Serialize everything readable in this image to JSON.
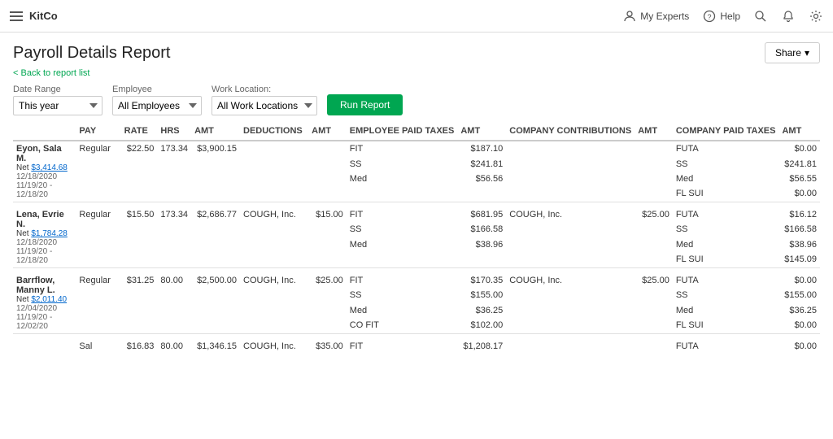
{
  "nav": {
    "brand": "KitCo",
    "my_experts": "My Experts",
    "help": "Help"
  },
  "page": {
    "title": "Payroll Details Report",
    "back_link": "Back to report list",
    "share_label": "Share"
  },
  "filters": {
    "date_range_label": "Date Range",
    "date_range_value": "This year",
    "employee_label": "Employee",
    "employee_value": "All Employees",
    "work_location_label": "Work Location:",
    "work_location_value": "All Work Locations",
    "run_report": "Run Report"
  },
  "table": {
    "headers": {
      "pay": "PAY",
      "rate": "RATE",
      "hrs": "HRS",
      "amt": "AMT",
      "deductions": "DEDUCTIONS",
      "d_amt": "AMT",
      "emp_taxes": "EMPLOYEE PAID TAXES",
      "e_amt": "AMT",
      "contributions": "COMPANY CONTRIBUTIONS",
      "c_amt": "AMT",
      "comp_taxes": "COMPANY PAID TAXES",
      "t_amt": "AMT"
    },
    "rows": [
      {
        "type": "employee",
        "name": "Eyon, Sala M.",
        "net": "$3,414.68",
        "date1": "12/18/2020",
        "date2": "11/19/20 - 12/18/20",
        "entries": [
          {
            "pay": "Regular",
            "rate": "$22.50",
            "hrs": "173.34",
            "amt": "$3,900.15",
            "deduction": "",
            "d_amt": "",
            "emp_tax": "FIT",
            "e_amt": "$187.10",
            "contrib": "",
            "c_amt": "",
            "comp_tax": "FUTA",
            "t_amt": "$0.00"
          },
          {
            "pay": "",
            "rate": "",
            "hrs": "",
            "amt": "",
            "deduction": "",
            "d_amt": "",
            "emp_tax": "SS",
            "e_amt": "$241.81",
            "contrib": "",
            "c_amt": "",
            "comp_tax": "SS",
            "t_amt": "$241.81"
          },
          {
            "pay": "",
            "rate": "",
            "hrs": "",
            "amt": "",
            "deduction": "",
            "d_amt": "",
            "emp_tax": "Med",
            "e_amt": "$56.56",
            "contrib": "",
            "c_amt": "",
            "comp_tax": "Med",
            "t_amt": "$56.55"
          },
          {
            "pay": "",
            "rate": "",
            "hrs": "",
            "amt": "",
            "deduction": "",
            "d_amt": "",
            "emp_tax": "",
            "e_amt": "",
            "contrib": "",
            "c_amt": "",
            "comp_tax": "FL SUI",
            "t_amt": "$0.00"
          }
        ]
      },
      {
        "type": "employee",
        "name": "Lena, Evrie N.",
        "net": "$1,784.28",
        "date1": "12/18/2020",
        "date2": "11/19/20 - 12/18/20",
        "entries": [
          {
            "pay": "Regular",
            "rate": "$15.50",
            "hrs": "173.34",
            "amt": "$2,686.77",
            "deduction": "COUGH, Inc.",
            "d_amt": "$15.00",
            "emp_tax": "FIT",
            "e_amt": "$681.95",
            "contrib": "COUGH, Inc.",
            "c_amt": "$25.00",
            "comp_tax": "FUTA",
            "t_amt": "$16.12"
          },
          {
            "pay": "",
            "rate": "",
            "hrs": "",
            "amt": "",
            "deduction": "",
            "d_amt": "",
            "emp_tax": "SS",
            "e_amt": "$166.58",
            "contrib": "",
            "c_amt": "",
            "comp_tax": "SS",
            "t_amt": "$166.58"
          },
          {
            "pay": "",
            "rate": "",
            "hrs": "",
            "amt": "",
            "deduction": "",
            "d_amt": "",
            "emp_tax": "Med",
            "e_amt": "$38.96",
            "contrib": "",
            "c_amt": "",
            "comp_tax": "Med",
            "t_amt": "$38.96"
          },
          {
            "pay": "",
            "rate": "",
            "hrs": "",
            "amt": "",
            "deduction": "",
            "d_amt": "",
            "emp_tax": "",
            "e_amt": "",
            "contrib": "",
            "c_amt": "",
            "comp_tax": "FL SUI",
            "t_amt": "$145.09"
          }
        ]
      },
      {
        "type": "employee",
        "name": "Barrflow, Manny L.",
        "net": "$2,011.40",
        "date1": "12/04/2020",
        "date2": "11/19/20 - 12/02/20",
        "entries": [
          {
            "pay": "Regular",
            "rate": "$31.25",
            "hrs": "80.00",
            "amt": "$2,500.00",
            "deduction": "COUGH, Inc.",
            "d_amt": "$25.00",
            "emp_tax": "FIT",
            "e_amt": "$170.35",
            "contrib": "COUGH, Inc.",
            "c_amt": "$25.00",
            "comp_tax": "FUTA",
            "t_amt": "$0.00"
          },
          {
            "pay": "",
            "rate": "",
            "hrs": "",
            "amt": "",
            "deduction": "",
            "d_amt": "",
            "emp_tax": "SS",
            "e_amt": "$155.00",
            "contrib": "",
            "c_amt": "",
            "comp_tax": "SS",
            "t_amt": "$155.00"
          },
          {
            "pay": "",
            "rate": "",
            "hrs": "",
            "amt": "",
            "deduction": "",
            "d_amt": "",
            "emp_tax": "Med",
            "e_amt": "$36.25",
            "contrib": "",
            "c_amt": "",
            "comp_tax": "Med",
            "t_amt": "$36.25"
          },
          {
            "pay": "",
            "rate": "",
            "hrs": "",
            "amt": "",
            "deduction": "",
            "d_amt": "",
            "emp_tax": "CO FIT",
            "e_amt": "$102.00",
            "contrib": "",
            "c_amt": "",
            "comp_tax": "FL SUI",
            "t_amt": "$0.00"
          }
        ]
      },
      {
        "type": "last_row",
        "entries": [
          {
            "pay": "Sal",
            "rate": "$16.83",
            "hrs": "80.00",
            "amt": "$1,346.15",
            "deduction": "COUGH, Inc.",
            "d_amt": "$35.00",
            "emp_tax": "FIT",
            "e_amt": "$1,208.17",
            "contrib": "",
            "c_amt": "",
            "comp_tax": "FUTA",
            "t_amt": "$0.00"
          }
        ]
      }
    ]
  }
}
